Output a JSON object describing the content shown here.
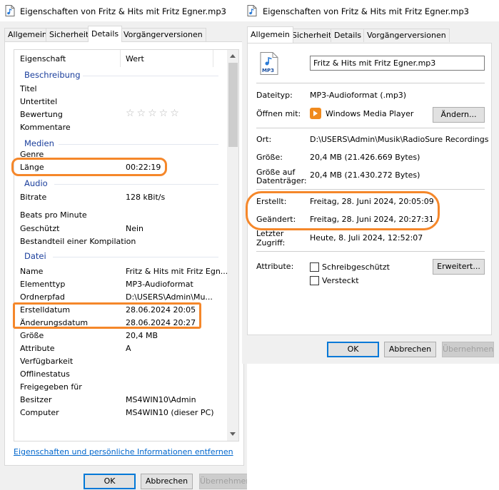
{
  "left_window": {
    "title": "Eigenschaften von Fritz & Hits mit Fritz Egner.mp3",
    "tabs": [
      "Allgemein",
      "Sicherheit",
      "Details",
      "Vorgängerversionen"
    ],
    "header": {
      "property": "Eigenschaft",
      "value": "Wert"
    },
    "groups": {
      "beschreibung": "Beschreibung",
      "medien": "Medien",
      "audio": "Audio",
      "datei": "Datei"
    },
    "rows": {
      "titel": "Titel",
      "untertitel": "Untertitel",
      "bewertung": "Bewertung",
      "bewertung_stars": "☆☆☆☆☆",
      "kommentare": "Kommentare",
      "genre": "Genre",
      "laenge": {
        "label": "Länge",
        "value": "00:22:19"
      },
      "bitrate": {
        "label": "Bitrate",
        "value": "128 kBit/s"
      },
      "beats": "Beats pro Minute",
      "geschuetzt": {
        "label": "Geschützt",
        "value": "Nein"
      },
      "bestandteil": "Bestandteil einer Kompilation",
      "name": {
        "label": "Name",
        "value": "Fritz & Hits mit Fritz Egn..."
      },
      "elementtyp": {
        "label": "Elementtyp",
        "value": "MP3-Audioformat"
      },
      "ordnerpfad": {
        "label": "Ordnerpfad",
        "value": "D:\\USERS\\Admin\\Mu..."
      },
      "erstelldatum": {
        "label": "Erstelldatum",
        "value": "28.06.2024 20:05"
      },
      "aenderungsdatum": {
        "label": "Änderungsdatum",
        "value": "28.06.2024 20:27"
      },
      "groesse": {
        "label": "Größe",
        "value": "20,4 MB"
      },
      "attribute": {
        "label": "Attribute",
        "value": "A"
      },
      "verfuegbarkeit": "Verfügbarkeit",
      "offlinestatus": "Offlinestatus",
      "freigegeben": "Freigegeben für",
      "besitzer": {
        "label": "Besitzer",
        "value": "MS4WIN10\\Admin"
      },
      "computer": {
        "label": "Computer",
        "value": "MS4WIN10 (dieser PC)"
      }
    },
    "link": "Eigenschaften und persönliche Informationen entfernen",
    "buttons": {
      "ok": "OK",
      "cancel": "Abbrechen",
      "apply": "Übernehmen"
    }
  },
  "right_window": {
    "title": "Eigenschaften von Fritz & Hits mit Fritz Egner.mp3",
    "tabs": [
      "Allgemein",
      "Sicherheit",
      "Details",
      "Vorgängerversionen"
    ],
    "file_icon_label": "MP3",
    "filename": "Fritz & Hits mit Fritz Egner.mp3",
    "dateityp": {
      "label": "Dateityp:",
      "value": "MP3-Audioformat (.mp3)"
    },
    "oeffnen": {
      "label": "Öffnen mit:",
      "value": "Windows Media Player",
      "button": "Ändern..."
    },
    "ort": {
      "label": "Ort:",
      "value": "D:\\USERS\\Admin\\Musik\\RadioSure Recordings\\BI"
    },
    "groesse": {
      "label": "Größe:",
      "value": "20,4 MB (21.426.669 Bytes)"
    },
    "groesse_dt": {
      "label_line1": "Größe auf",
      "label_line2": "Datenträger:",
      "value": "20,4 MB (21.430.272 Bytes)"
    },
    "erstellt": {
      "label": "Erstellt:",
      "value": "Freitag, 28. Juni 2024, 20:05:09"
    },
    "geaendert": {
      "label": "Geändert:",
      "value": "Freitag, 28. Juni 2024, 20:27:31"
    },
    "zugriff": {
      "label_line1": "Letzter",
      "label_line2": "Zugriff:",
      "value": "Heute, 8. Juli 2024, 12:52:07"
    },
    "attribute": {
      "label": "Attribute:",
      "readonly": "Schreibgeschützt",
      "hidden": "Versteckt",
      "advanced": "Erweitert..."
    },
    "buttons": {
      "ok": "OK",
      "cancel": "Abbrechen",
      "apply": "Übernehmen"
    }
  },
  "colors": {
    "highlight": "#f5872a",
    "group_heading": "#1a3e9c",
    "link": "#0066cc",
    "focus": "#0078d7"
  }
}
